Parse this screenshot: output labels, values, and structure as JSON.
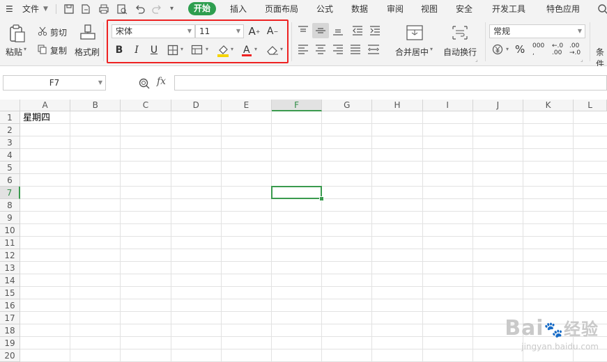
{
  "menubar": {
    "file_label": "文件",
    "tabs": [
      "开始",
      "插入",
      "页面布局",
      "公式",
      "数据",
      "审阅",
      "视图",
      "安全",
      "开发工具",
      "特色应用"
    ]
  },
  "ribbon": {
    "paste_label": "粘贴",
    "cut_label": "剪切",
    "copy_label": "复制",
    "format_painter_label": "格式刷",
    "font_name": "宋体",
    "font_size": "11",
    "bold_label": "B",
    "italic_label": "I",
    "underline_label": "U",
    "merge_center_label": "合并居中",
    "wrap_text_label": "自动换行",
    "number_format": "常规",
    "percent_label": "%",
    "thousands_label": "000",
    "decimal_inc_label": ".00",
    "decimal_dec_label": ".00",
    "conditional_label": "条件"
  },
  "formula_bar": {
    "cell_ref": "F7",
    "fx_label": "fx",
    "content": ""
  },
  "sheet": {
    "columns": [
      "A",
      "B",
      "C",
      "D",
      "E",
      "F",
      "G",
      "H",
      "I",
      "J",
      "K",
      "L"
    ],
    "rows": [
      "1",
      "2",
      "3",
      "4",
      "5",
      "6",
      "7",
      "8",
      "9",
      "10",
      "11",
      "12",
      "13",
      "14",
      "15",
      "16",
      "17",
      "18",
      "19",
      "20"
    ],
    "cell_a1": "星期四",
    "active_column": "F",
    "active_row": "7"
  },
  "watermark": {
    "brand": "Bai",
    "brand_suffix": "经验",
    "url": "jingyan.baidu.com"
  },
  "colors": {
    "accent": "#2e9e4f",
    "highlight_box": "#e22222",
    "selection": "#3a9a4e"
  }
}
